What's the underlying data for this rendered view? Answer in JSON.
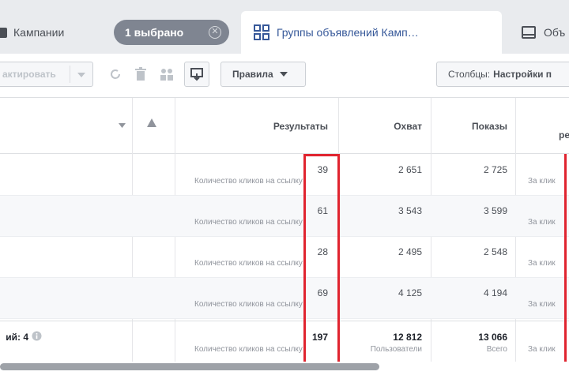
{
  "tabs": {
    "campaigns_label": "Кампании",
    "selected_pill": "1 выбрано",
    "adsets_label": "Группы объявлений Камп…",
    "ads_label": "Объ"
  },
  "toolbar": {
    "edit_label": "актировать",
    "rules_label": "Правила",
    "columns_prefix": "Столбцы:",
    "columns_value": "Настройки п"
  },
  "table": {
    "headers": {
      "results": "Результаты",
      "reach": "Охват",
      "impressions": "Показы",
      "cost_partial": "ре"
    },
    "rows": [
      {
        "results": "39",
        "results_sub": "Количество кликов на ссылку",
        "reach": "2 651",
        "impressions": "2 725",
        "cost_sub": "За клик"
      },
      {
        "results": "61",
        "results_sub": "Количество кликов на ссылку",
        "reach": "3 543",
        "impressions": "3 599",
        "cost_sub": "За клик"
      },
      {
        "results": "28",
        "results_sub": "Количество кликов на ссылку",
        "reach": "2 495",
        "impressions": "2 548",
        "cost_sub": "За клик"
      },
      {
        "results": "69",
        "results_sub": "Количество кликов на ссылку",
        "reach": "4 125",
        "impressions": "4 194",
        "cost_sub": "За клик"
      }
    ],
    "summary": {
      "label": "ий: 4",
      "results": "197",
      "results_sub": "Количество кликов на ссылку",
      "reach": "12 812",
      "reach_sub": "Пользователи",
      "impressions": "13 066",
      "impressions_sub": "Всего",
      "cost_sub": "За клик"
    }
  },
  "colors": {
    "highlight": "#e0242f",
    "link": "#365899"
  }
}
